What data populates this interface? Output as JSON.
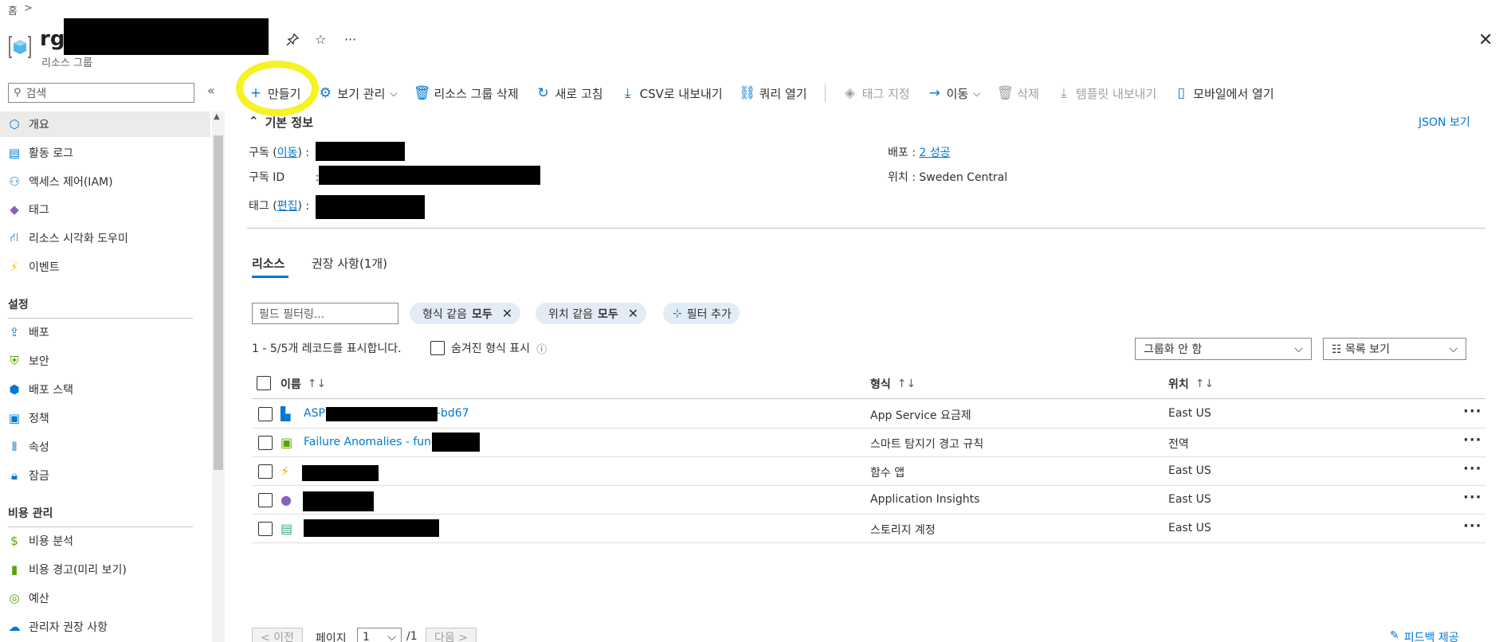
{
  "breadcrumb": {
    "home": "홈",
    "sep": ">"
  },
  "header": {
    "title": "rg",
    "subtitle": "리소스 그룹",
    "pin_icon": "pin-icon",
    "star_icon": "star-icon",
    "more": "···",
    "close": "✕"
  },
  "sidebar": {
    "search_placeholder": "검색",
    "collapse": "«",
    "items": [
      {
        "label": "개요",
        "icon": "overview-icon"
      },
      {
        "label": "활동 로그",
        "icon": "activity-log-icon"
      },
      {
        "label": "액세스 제어(IAM)",
        "icon": "iam-icon"
      },
      {
        "label": "태그",
        "icon": "tag-icon"
      },
      {
        "label": "리소스 시각화 도우미",
        "icon": "visualizer-icon"
      },
      {
        "label": "이벤트",
        "icon": "lightning-icon"
      }
    ],
    "section_settings": "설정",
    "settings_items": [
      {
        "label": "배포",
        "icon": "deploy-icon"
      },
      {
        "label": "보안",
        "icon": "security-icon"
      },
      {
        "label": "배포 스택",
        "icon": "stack-icon"
      },
      {
        "label": "정책",
        "icon": "policy-icon"
      },
      {
        "label": "속성",
        "icon": "properties-icon"
      },
      {
        "label": "잠금",
        "icon": "lock-icon"
      }
    ],
    "section_cost": "비용 관리",
    "cost_items": [
      {
        "label": "비용 분석",
        "icon": "cost-analysis-icon"
      },
      {
        "label": "비용 경고(미리 보기)",
        "icon": "cost-alert-icon"
      },
      {
        "label": "예산",
        "icon": "budget-icon"
      },
      {
        "label": "관리자 권장 사항",
        "icon": "advisor-icon"
      }
    ]
  },
  "toolbar": {
    "create": "만들기",
    "manage_view": "보기 관리",
    "delete_rg": "리소스 그룹 삭제",
    "refresh": "새로 고침",
    "export_csv": "CSV로 내보내기",
    "open_query": "쿼리 열기",
    "assign_tags": "태그 지정",
    "move": "이동",
    "delete": "삭제",
    "export_template": "템플릿 내보내기",
    "open_mobile": "모바일에서 열기"
  },
  "essentials": {
    "toggle": "기본 정보",
    "json_view": "JSON 보기",
    "subscription_label": "구독",
    "subscription_link": "이동",
    "subscription_id_label": "구독 ID",
    "tags_label": "태그",
    "tags_link": "편집",
    "deployments_label": "배포",
    "deployments_value": "2 성공",
    "location_label": "위치",
    "location_value": "Sweden Central",
    "colon": ":"
  },
  "tabs": {
    "resources": "리소스",
    "recommendations": "권장 사항(1개)"
  },
  "filters": {
    "placeholder": "필드 필터링...",
    "type_prefix": "형식 같음",
    "type_value": "모두",
    "location_prefix": "위치 같음",
    "location_value": "모두",
    "add_filter": "필터 추가"
  },
  "records": {
    "count_text": "1 - 5/5개 레코드를 표시합니다.",
    "show_hidden": "숨겨진 형식 표시",
    "grouping": "그룹화 안 함",
    "view": "목록 보기"
  },
  "table": {
    "col_name": "이름",
    "col_type": "형식",
    "col_location": "위치",
    "sort_name": "↑↓",
    "sort_type": "↑↓",
    "sort_location": "↑↓",
    "rows": [
      {
        "name_prefix": "ASP",
        "name_suffix": "-bd67",
        "type": "App Service 요금제",
        "location": "East US",
        "icon": "app-service-plan-icon"
      },
      {
        "name_prefix": "Failure Anomalies - func",
        "name_suffix": "",
        "type": "스마트 탐지기 경고 규칙",
        "location": "전역",
        "icon": "smart-detector-icon"
      },
      {
        "name_prefix": "",
        "name_suffix": "",
        "type": "함수 앱",
        "location": "East US",
        "icon": "function-app-icon"
      },
      {
        "name_prefix": "",
        "name_suffix": "",
        "type": "Application Insights",
        "location": "East US",
        "icon": "app-insights-icon"
      },
      {
        "name_prefix": "",
        "name_suffix": "",
        "type": "스토리지 계정",
        "location": "East US",
        "icon": "storage-icon"
      }
    ]
  },
  "pagination": {
    "prev": "< 이전",
    "page_label": "페이지",
    "page_value": "1",
    "total": "/1",
    "next": "다음 >"
  },
  "feedback": "피드백 제공",
  "colors": {
    "accent": "#0078d4",
    "highlight": "#f4f000"
  }
}
